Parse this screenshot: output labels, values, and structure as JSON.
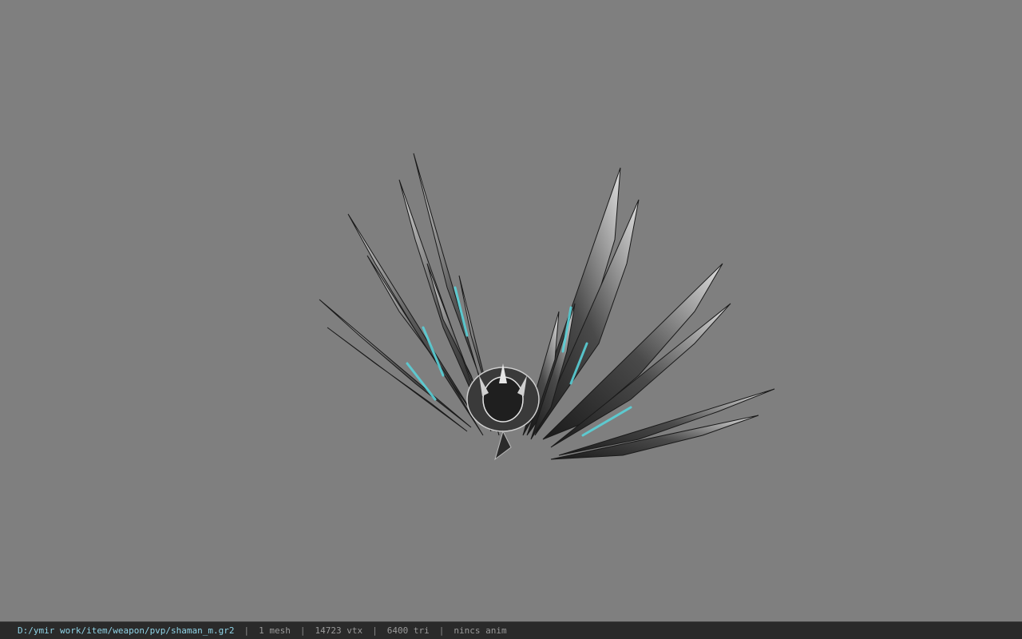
{
  "viewer": {
    "model_icon": "spiked-wing-weapon-model",
    "accent_color": "#5ad1d8",
    "background_color": "#7f7f7f"
  },
  "status_bar": {
    "file_path": "D:/ymir work/item/weapon/pvp/shaman_m.gr2",
    "mesh_count": "1 mesh",
    "vertex_count": "14723 vtx",
    "triangle_count": "6400 tri",
    "anim_status": "nincs anim",
    "separator": "|"
  }
}
